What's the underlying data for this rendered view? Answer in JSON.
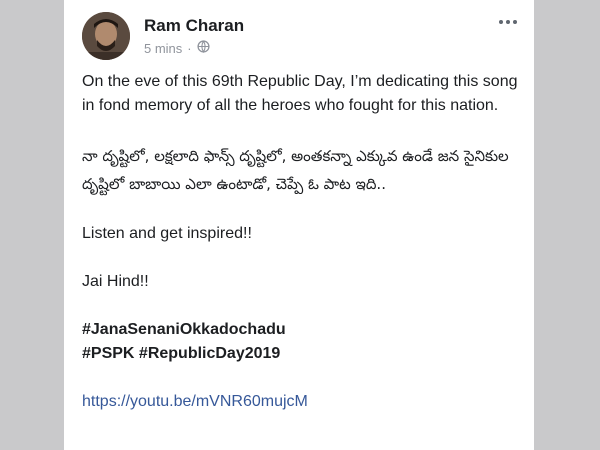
{
  "post": {
    "author": "Ram Charan",
    "time": "5 mins",
    "separator": "·",
    "privacy_icon": "globe-icon",
    "more_icon": "more-options-icon",
    "paragraph_1": "On the eve of this 69th Republic Day, I’m dedicating this song in fond memory of all the heroes who fought for this nation.",
    "paragraph_telugu": "నా దృష్టిలో, లక్షలాది ఫాన్స్ దృష్టిలో, అంతకన్నా ఎక్కువ ఉండే జన సైనికుల దృష్టిలో బాబాయి ఎలా ఉంటాడో, చెప్పే ఓ పాట ఇది..",
    "paragraph_2": "Listen and get inspired!!",
    "paragraph_3": "Jai Hind!!",
    "hashtags": [
      "#JanaSenaniOkkadochadu",
      "#PSPK #RepublicDay2019"
    ],
    "link": "https://youtu.be/mVNR60mujcM"
  },
  "colors": {
    "background": "#c9c9cb",
    "card": "#ffffff",
    "text": "#1c1e21",
    "meta": "#90949c",
    "link": "#365899"
  }
}
